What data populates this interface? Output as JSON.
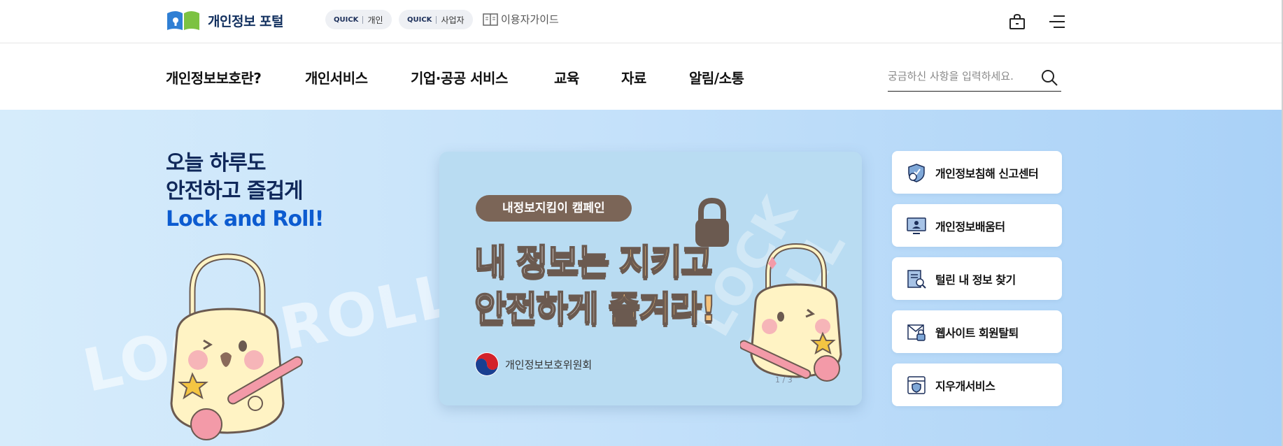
{
  "logo": {
    "text": "개인정보 포털"
  },
  "quick_links": [
    {
      "prefix": "QUICK",
      "label": "개인"
    },
    {
      "prefix": "QUICK",
      "label": "사업자"
    }
  ],
  "user_guide": {
    "label": "이용자가이드",
    "icon": "book-icon"
  },
  "util_icons": [
    "shopping-bag-icon",
    "menu-icon"
  ],
  "nav": {
    "items": [
      "개인정보보호란?",
      "개인서비스",
      "기업·공공 서비스",
      "교육",
      "자료",
      "알림/소통"
    ]
  },
  "search": {
    "placeholder": "궁금하신 사항을 입력하세요.",
    "icon": "search-icon"
  },
  "hero": {
    "line1": "오늘 하루도",
    "line2": "안전하고 즐겁게",
    "line3": "Lock and Roll!",
    "bg_text_1": "LOCK ROLL",
    "bg_text_2": "LOCK ROLL"
  },
  "banner": {
    "pill": "내정보지킴이 캠페인",
    "line1_a": "내 정보는 ",
    "line1_b": "지키고",
    "line2_a": "안전하게 ",
    "line2_b": "즐겨라!",
    "org": "개인정보보호위원회",
    "pager": "1 / 3"
  },
  "services": [
    {
      "label": "개인정보침해 신고센터",
      "icon": "shield-report-icon"
    },
    {
      "label": "개인정보배움터",
      "icon": "monitor-learning-icon"
    },
    {
      "label": "털린 내 정보 찾기",
      "icon": "document-search-icon"
    },
    {
      "label": "웹사이트 회원탈퇴",
      "icon": "envelope-lock-icon"
    },
    {
      "label": "지우개서비스",
      "icon": "browser-shield-icon"
    }
  ],
  "colors": {
    "brand_navy": "#12305f",
    "accent_blue": "#0c5bd0",
    "hero_bg": "#c6e2fa",
    "pill_brown": "#7b6557",
    "highlight_orange": "#f5c27a"
  }
}
